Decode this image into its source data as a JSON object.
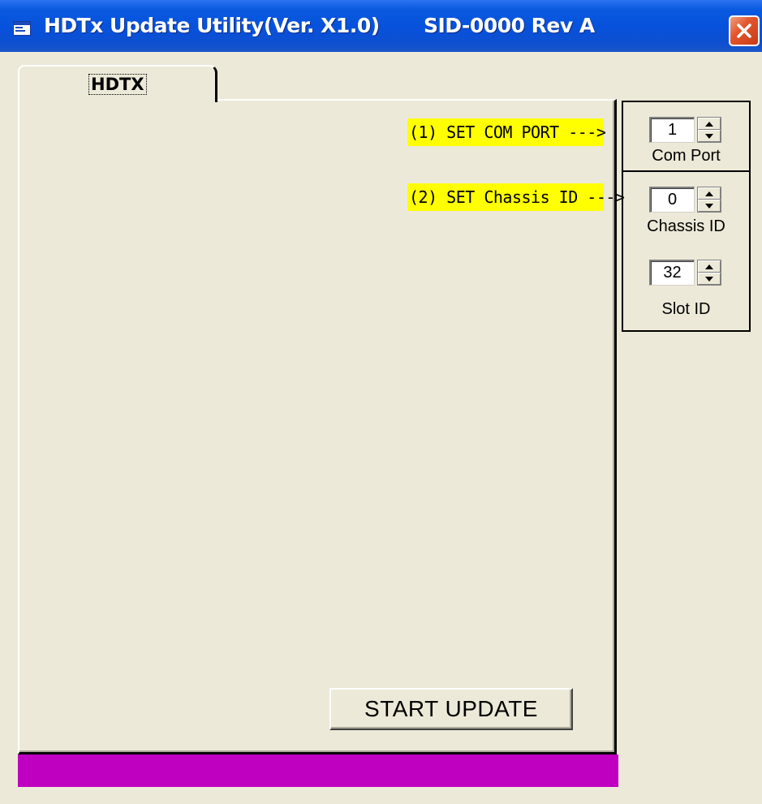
{
  "window": {
    "title": "HDTx Update Utility(Ver. X1.0)",
    "revision": "SID-0000 Rev A",
    "icon": "app-window-icon",
    "close_icon": "close-icon"
  },
  "tab": {
    "label": "HDTX"
  },
  "instructions": {
    "step1": "(1)  SET COM PORT --->",
    "step2": "(2)  SET Chassis ID --->"
  },
  "com_port": {
    "value": "1",
    "label": "Com Port"
  },
  "chassis_id": {
    "value": "0",
    "label": "Chassis ID"
  },
  "slot_id": {
    "value": "32",
    "label": "Slot ID"
  },
  "start_button": {
    "label": "START UPDATE"
  },
  "colors": {
    "titlebar": "#0752dc",
    "instruction_highlight": "#ffff00",
    "status_bar": "#c000c0",
    "background": "#ece9d8"
  }
}
